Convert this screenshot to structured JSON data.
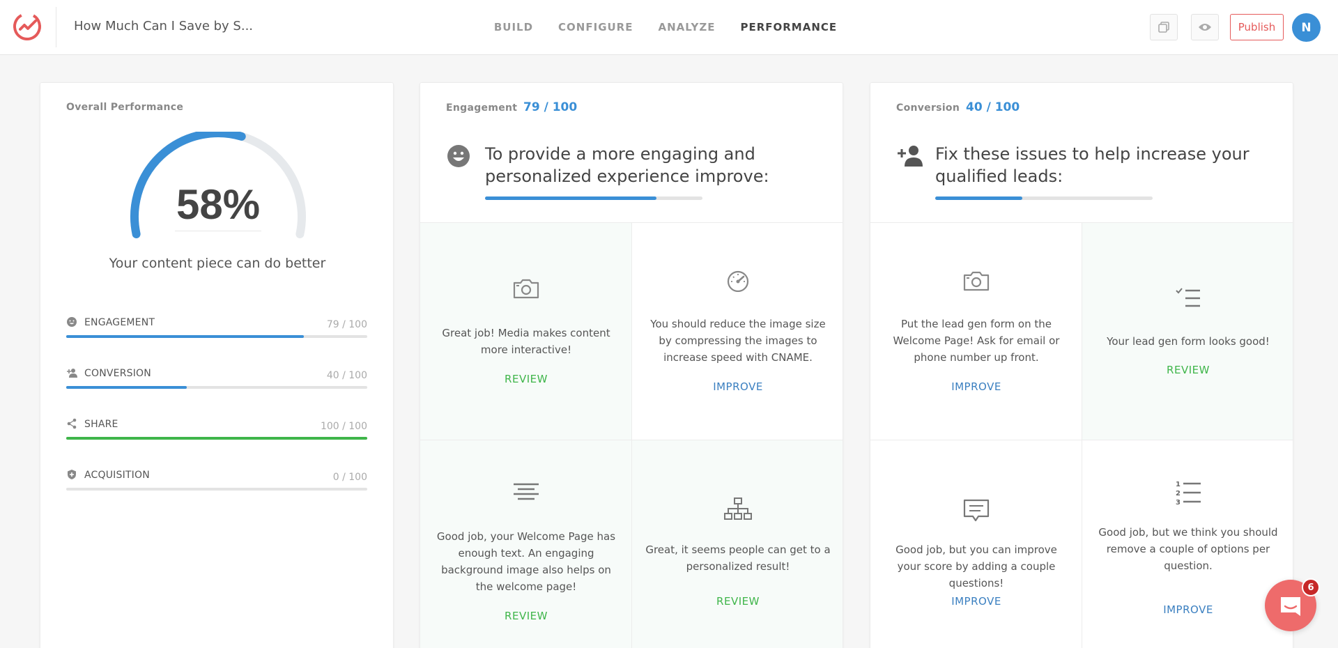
{
  "topbar": {
    "doc_title": "How Much Can I Save by S...",
    "nav": [
      {
        "label": "BUILD"
      },
      {
        "label": "CONFIGURE"
      },
      {
        "label": "ANALYZE"
      },
      {
        "label": "PERFORMANCE",
        "active": true
      }
    ],
    "publish_label": "Publish",
    "avatar_initial": "N",
    "icons": [
      "duplicate-icon",
      "eye-icon"
    ],
    "colors": {
      "brand": "#e55a5a",
      "accent": "#3a8fd6"
    }
  },
  "overall": {
    "label": "Overall Performance",
    "percent_value": 58,
    "percent_text": "58%",
    "subtitle": "Your content piece can do better",
    "metrics": [
      {
        "icon": "smiley-icon",
        "name": "ENGAGEMENT",
        "score": "79 / 100",
        "value": 79,
        "color": "#3a8fd6"
      },
      {
        "icon": "add-person-icon",
        "name": "CONVERSION",
        "score": "40 / 100",
        "value": 40,
        "color": "#3a8fd6"
      },
      {
        "icon": "share-icon",
        "name": "SHARE",
        "score": "100 / 100",
        "value": 100,
        "color": "#3fb54a"
      },
      {
        "icon": "shield-icon",
        "name": "ACQUISITION",
        "score": "0 / 100",
        "value": 0,
        "color": "#3a8fd6"
      }
    ]
  },
  "engagement": {
    "label": "Engagement",
    "score": "79 / 100",
    "value": 79,
    "heading": "To provide a more engaging and personalized experience improve:",
    "icon": "smiley-icon",
    "tiles": [
      {
        "icon": "camera-icon",
        "text": "Great job! Media makes content more interactive!",
        "action": "REVIEW",
        "status": "good"
      },
      {
        "icon": "speedometer-icon",
        "text": "You should reduce the image size by compressing the images to increase speed with CNAME.",
        "action": "IMPROVE",
        "status": "bad"
      },
      {
        "icon": "align-text-icon",
        "text": "Good job, your Welcome Page has enough text. An engaging background image also helps on the welcome page!",
        "action": "REVIEW",
        "status": "good"
      },
      {
        "icon": "sitemap-icon",
        "text": "Great, it seems people can get to a personalized result!",
        "action": "REVIEW",
        "status": "good"
      }
    ]
  },
  "conversion": {
    "label": "Conversion",
    "score": "40 / 100",
    "value": 40,
    "heading": "Fix these issues to help increase your qualified leads:",
    "icon": "add-person-icon",
    "tiles": [
      {
        "icon": "camera-icon",
        "text": "Put the lead gen form on the Welcome Page! Ask for email or phone number up front.",
        "action": "IMPROVE",
        "status": "bad"
      },
      {
        "icon": "checklist-icon",
        "text": "Your lead gen form looks good!",
        "action": "REVIEW",
        "status": "good"
      },
      {
        "icon": "comment-icon",
        "text": "Good job, but you can improve your score by adding a couple questions!",
        "action": "IMPROVE",
        "status": "bad"
      },
      {
        "icon": "numbered-list-icon",
        "text": "Good job, but we think you should remove a couple of options per question.",
        "action": "IMPROVE",
        "status": "bad"
      }
    ]
  },
  "chat": {
    "badge": "6",
    "icon": "chat-icon"
  }
}
